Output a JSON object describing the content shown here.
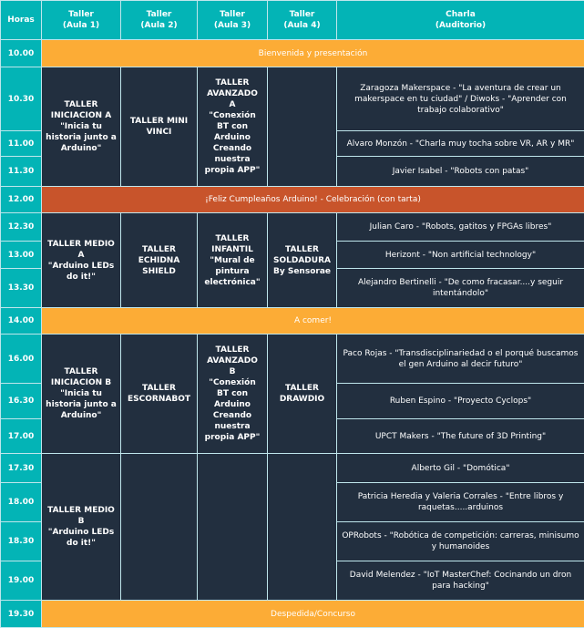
{
  "header": {
    "hours": "Horas",
    "aula1": [
      "Taller",
      "(Aula 1)"
    ],
    "aula2": [
      "Taller",
      "(Aula 2)"
    ],
    "aula3": [
      "Taller",
      "(Aula 3)"
    ],
    "aula4": [
      "Taller",
      "(Aula 4)"
    ],
    "charla": [
      "Charla",
      "(Auditorio)"
    ]
  },
  "colors": {
    "teal": "#03b4b6",
    "orange": "#fcac36",
    "red": "#c8542b",
    "navy": "#222f3f"
  },
  "hours": [
    "10.00",
    "10.30",
    "11.00",
    "11.30",
    "12.00",
    "12.30",
    "13.00",
    "13.30",
    "14.00",
    "16.00",
    "16.30",
    "17.00",
    "17.30",
    "18.00",
    "18.30",
    "19.00",
    "19.30"
  ],
  "bands": {
    "welcome": "Bienvenida y presentación",
    "birthday": "¡Feliz Cumpleaños Arduino! - Celebración (con tarta)",
    "lunch": "A comer!",
    "farewell": "Despedida/Concurso"
  },
  "workshops": {
    "iniciacion_a": [
      "TALLER",
      "INICIACION A",
      "\"Inicia tu",
      "historia junto a",
      "Arduino\""
    ],
    "mini_vinci": [
      "TALLER MINI",
      "VINCI"
    ],
    "avanzado_a": [
      "TALLER",
      "AVANZADO",
      "A",
      "\"Conexión",
      "BT con",
      "Arduino",
      "Creando",
      "nuestra",
      "propia APP\""
    ],
    "medio_a": [
      "TALLER MEDIO",
      "A",
      "\"Arduino LEDs",
      "do it!\""
    ],
    "echidna": [
      "TALLER",
      "ECHIDNA",
      "SHIELD"
    ],
    "infantil": [
      "TALLER",
      "INFANTIL",
      "\"Mural de",
      "pintura",
      "electrónica\""
    ],
    "soldadura": [
      "TALLER",
      "SOLDADURA",
      "By Sensorae"
    ],
    "iniciacion_b": [
      "TALLER",
      "INICIACION B",
      "\"Inicia tu",
      "historia junto a",
      "Arduino\""
    ],
    "escornabot": [
      "TALLER",
      "ESCORNABOT"
    ],
    "avanzado_b": [
      "TALLER",
      "AVANZADO",
      "B",
      "\"Conexión",
      "BT con",
      "Arduino",
      "Creando",
      "nuestra",
      "propia APP\""
    ],
    "drawdio": [
      "TALLER",
      "DRAWDIO"
    ],
    "medio_b": [
      "TALLER MEDIO",
      "B",
      "\"Arduino LEDs",
      "do it!\""
    ]
  },
  "talks": [
    "Zaragoza Makerspace - \"La aventura de crear un makerspace en tu ciudad\" / Diwoks - \"Aprender con trabajo colaborativo\"",
    "Alvaro Monzón - \"Charla muy tocha sobre VR, AR y MR\"",
    "Javier Isabel - \"Robots con patas\"",
    "Julian Caro - \"Robots, gatitos y FPGAs libres\"",
    "Herizont - \"Non artificial technology\"",
    "Alejandro Bertinelli - \"De como fracasar....y seguir intentándolo\"",
    "Paco Rojas - \"Transdisciplinariedad o el porqué buscamos el gen Arduino al decir futuro\"",
    "Ruben Espino - \"Proyecto Cyclops\"",
    "UPCT Makers - \"The future of 3D Printing\"",
    "Alberto Gil - \"Domótica\"",
    "Patricia Heredia y Valeria Corrales - \"Entre libros y raquetas.....arduinos",
    "OPRobots - \"Robótica de competición: carreras, minisumo y humanoides",
    "David Melendez - \"IoT MasterChef: Cocinando un dron para hacking\""
  ]
}
